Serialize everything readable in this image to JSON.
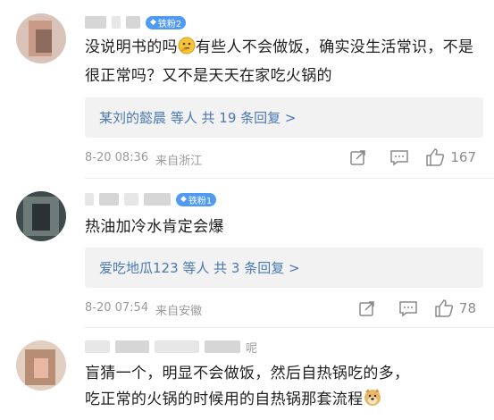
{
  "comments": [
    {
      "badge": "铁粉2",
      "text": "没说明书的吗🤔有些人不会做饭，确实没生活常识，不是很正常吗？又不是天天在家吃火锅的",
      "text_before_emoji": "没说明书的吗",
      "text_after_emoji": "有些人不会做饭，确实没生活常识，不是很正常吗？又不是天天在家吃火锅的",
      "replies_label": "某刘的懿晨 等人  共 19 条回复 >",
      "date": "8-20 08:36",
      "location": "来自浙江",
      "likes": "167"
    },
    {
      "badge": "铁粉1",
      "text": "热油加冷水肯定会爆",
      "replies_label": "爱吃地瓜123 等人  共 3 条回复 >",
      "date": "8-20 07:54",
      "location": "来自安徽",
      "likes": "78"
    },
    {
      "name_suffix": "呢",
      "text_line1": "盲猜一个，明显不会做饭，然后自热锅吃的多，",
      "text_line2": "吃正常的火锅的时候用的自热锅那套流程"
    }
  ],
  "icons": {
    "forward": "forward-icon",
    "comment": "comment-icon",
    "like": "thumbs-up-icon",
    "badge_diamond": "diamond-icon"
  },
  "colors": {
    "link": "#4a78b0",
    "badge": "#4f9af5",
    "meta": "#9a9a9a"
  }
}
